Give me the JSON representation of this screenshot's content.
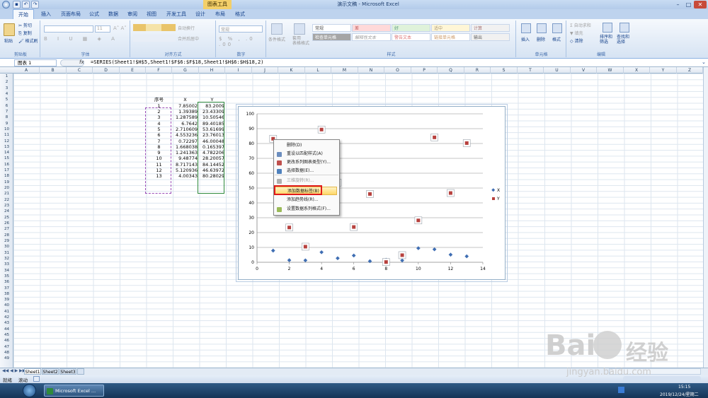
{
  "window": {
    "title": "演示文稿 - Microsoft Excel",
    "context_tool": "图表工具"
  },
  "tabs": [
    "开始",
    "插入",
    "页面布局",
    "公式",
    "数据",
    "审阅",
    "视图",
    "开发工具",
    "设计",
    "布局",
    "格式"
  ],
  "ribbon": {
    "clipboard": {
      "label": "剪贴板",
      "paste": "粘贴",
      "cut": "剪切",
      "copy": "复制",
      "format_painter": "格式刷"
    },
    "font": {
      "label": "字体",
      "size": "11"
    },
    "alignment": {
      "label": "对齐方式",
      "wrap": "自动换行",
      "merge": "合并后居中"
    },
    "number": {
      "label": "数字",
      "format": "常规"
    },
    "styles": {
      "label": "样式",
      "cond": "条件格式",
      "table": "套用\n表格格式",
      "cells": [
        "常规",
        "差",
        "好",
        "适中",
        "计算",
        "检查单元格",
        "解释性文本",
        "警告文本",
        "链接单元格",
        "输出"
      ]
    },
    "cells": {
      "label": "单元格",
      "insert": "插入",
      "delete": "删除",
      "format": "格式"
    },
    "editing": {
      "label": "编辑",
      "autosum": "自动求和",
      "fill": "填充",
      "clear": "清除",
      "sort": "排序和\n筛选",
      "find": "查找和\n选择"
    }
  },
  "formula_bar": {
    "name_box": "图表 1",
    "fx": "fx",
    "formula": "=SERIES(Sheet1!$H$5,Sheet1!$F$6:$F$18,Sheet1!$H$6:$H$18,2)"
  },
  "columns": [
    "A",
    "B",
    "C",
    "D",
    "E",
    "F",
    "G",
    "H",
    "I",
    "J",
    "K",
    "L",
    "M",
    "N",
    "O",
    "P",
    "Q",
    "R",
    "S",
    "T",
    "U",
    "V",
    "W",
    "X",
    "Y",
    "Z"
  ],
  "rows": [
    "1",
    "2",
    "3",
    "4",
    "5",
    "6",
    "7",
    "8",
    "9",
    "10",
    "11",
    "12",
    "13",
    "14",
    "15",
    "16",
    "17",
    "18",
    "19",
    "20",
    "21",
    "22",
    "23",
    "24",
    "25",
    "26",
    "27",
    "28",
    "29",
    "30",
    "31",
    "32",
    "33",
    "34",
    "35",
    "36",
    "37",
    "38",
    "39",
    "40",
    "41",
    "42",
    "43",
    "44",
    "45",
    "46",
    "47",
    "48",
    "49"
  ],
  "table": {
    "headers": [
      "序号",
      "X",
      "Y"
    ],
    "rows": [
      [
        "1",
        "7.85002",
        "83.2009"
      ],
      [
        "2",
        "1.39389",
        "23.43309"
      ],
      [
        "3",
        "1.287589",
        "10.50546"
      ],
      [
        "4",
        "6.7642",
        "89.40185"
      ],
      [
        "5",
        "2.710609",
        "53.61699"
      ],
      [
        "6",
        "4.553236",
        "23.76013"
      ],
      [
        "7",
        "0.72297",
        "46.00048"
      ],
      [
        "8",
        "1.668038",
        "0.165397"
      ],
      [
        "9",
        "1.241363",
        "4.782206"
      ],
      [
        "10",
        "9.48774",
        "28.20057"
      ],
      [
        "11",
        "8.717143",
        "84.14452"
      ],
      [
        "12",
        "5.120936",
        "46.63972"
      ],
      [
        "13",
        "4.00343",
        "80.28029"
      ]
    ]
  },
  "chart_data": {
    "type": "scatter",
    "x": [
      1,
      2,
      3,
      4,
      5,
      6,
      7,
      8,
      9,
      10,
      11,
      12,
      13
    ],
    "series": [
      {
        "name": "X",
        "values": [
          7.85002,
          1.39389,
          1.287589,
          6.7642,
          2.710609,
          4.553236,
          0.72297,
          1.668038,
          1.241363,
          9.48774,
          8.717143,
          5.120936,
          4.00343
        ],
        "color": "#3f6eb3"
      },
      {
        "name": "Y",
        "values": [
          83.2009,
          23.43309,
          10.50546,
          89.40185,
          53.61699,
          23.76013,
          46.00048,
          0.165397,
          4.782206,
          28.20057,
          84.14452,
          46.63972,
          80.28029
        ],
        "color": "#b7413e"
      }
    ],
    "xlim": [
      0,
      14
    ],
    "ylim": [
      0,
      100
    ],
    "xticks": [
      "0",
      "2",
      "4",
      "6",
      "8",
      "10",
      "12",
      "14"
    ],
    "yticks": [
      "0",
      "10",
      "20",
      "30",
      "40",
      "50",
      "60",
      "70",
      "80",
      "90",
      "100"
    ],
    "grid": "horizontal",
    "legend": "right"
  },
  "context_menu": [
    {
      "label": "删除(D)",
      "icon": "none",
      "disabled": false
    },
    {
      "label": "重设以匹配样式(A)",
      "icon": "reset-icon",
      "disabled": false
    },
    {
      "label": "更改系列图表类型(Y)...",
      "icon": "chart-type-icon",
      "disabled": false
    },
    {
      "label": "选择数据(E)...",
      "icon": "select-data-icon",
      "disabled": false
    },
    {
      "label": "三维旋转(R)...",
      "icon": "rotate-icon",
      "disabled": true
    },
    {
      "label": "添加数据标签(B)",
      "icon": "none",
      "disabled": false,
      "highlighted": true
    },
    {
      "label": "添加趋势线(R)...",
      "icon": "none",
      "disabled": false
    },
    {
      "label": "设置数据系列格式(F)...",
      "icon": "format-series-icon",
      "disabled": false
    }
  ],
  "sheets": [
    "Sheet1",
    "Sheet2",
    "Sheet3"
  ],
  "status": {
    "ready": "就绪",
    "mode": "滚动"
  },
  "taskbar": {
    "app": "Microsoft Excel ...",
    "time": "15:15",
    "date": "2019/12/24/星期二"
  },
  "watermark": {
    "brand": "Bai",
    "brand2": "经验",
    "url": "jingyan.baidu.com"
  }
}
